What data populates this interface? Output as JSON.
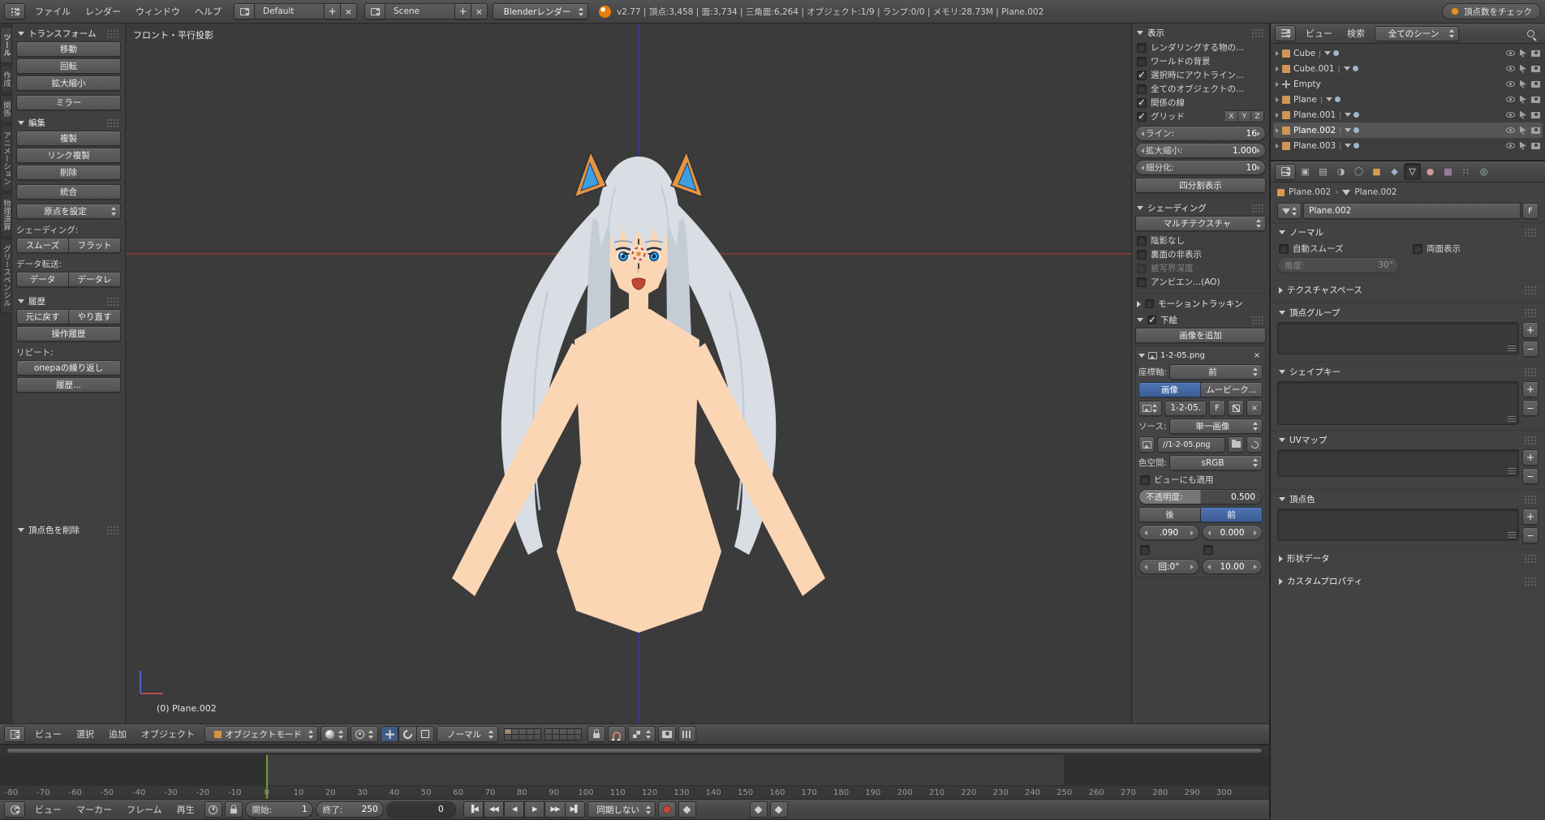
{
  "topbar": {
    "menus": [
      "ファイル",
      "レンダー",
      "ウィンドウ",
      "ヘルプ"
    ],
    "layout": {
      "value": "Default"
    },
    "scene": {
      "value": "Scene"
    },
    "engine": {
      "value": "Blenderレンダー"
    },
    "stats": "v2.77 | 頂点:3,458 | 面:3,734 | 三角面:6,264 | オブジェクト:1/9 | ランプ:0/0 | メモリ:28.73M | Plane.002",
    "job_button": "頂点数をチェック"
  },
  "toolshelf": {
    "tabs": [
      {
        "label": "ツール",
        "active": true
      },
      {
        "label": "作成"
      },
      {
        "label": "関係"
      },
      {
        "label": "アニメーション"
      },
      {
        "label": "物理演算"
      },
      {
        "label": "グリースペンシル"
      }
    ],
    "transform_title": "トランスフォーム",
    "transform_buttons": [
      "移動",
      "回転",
      "拡大縮小"
    ],
    "mirror_button": "ミラー",
    "edit_title": "編集",
    "edit_buttons": [
      "複製",
      "リンク複製",
      "削除"
    ],
    "join_button": "統合",
    "origin_button": "原点を設定",
    "shading_label": "シェーディング:",
    "smooth_button": "スムーズ",
    "flat_button": "フラット",
    "transfer_label": "データ転送:",
    "data_button": "データ",
    "data_layout_button": "データレ",
    "history_title": "履歴",
    "undo_button": "元に戻す",
    "redo_button": "やり直す",
    "history_button": "操作履歴",
    "repeat_label": "リピート:",
    "repeat_button": "операの繰り返し",
    "repeat_history_button": "履歴...",
    "vertex_color_panel": "頂点色を削除"
  },
  "viewport": {
    "view_label": "フロント・平行投影",
    "object_label": "(0) Plane.002",
    "menus": [
      "ビュー",
      "選択",
      "追加",
      "オブジェクト"
    ],
    "mode_value": "オブジェクトモード",
    "orientation_value": "ノーマル"
  },
  "npanel": {
    "display": {
      "title": "表示",
      "options": [
        {
          "label": "レンダリングする物の...",
          "checked": false
        },
        {
          "label": "ワールドの背景",
          "checked": false
        },
        {
          "label": "選択時にアウトライン...",
          "checked": true
        },
        {
          "label": "全てのオブジェクトの...",
          "checked": false
        },
        {
          "label": "関係の線",
          "checked": true
        }
      ],
      "grid_label": "グリッド",
      "grid_axes": [
        "X",
        "Y",
        "Z"
      ],
      "fields": [
        {
          "label": "ライン:",
          "value": "16"
        },
        {
          "label": "拡大縮小:",
          "value": "1.000"
        },
        {
          "label": "細分化:",
          "value": "10"
        }
      ],
      "quad_view_button": "四分割表示"
    },
    "shading": {
      "title": "シェーディング",
      "mode": "マルチテクスチャ",
      "options": [
        {
          "label": "陰影なし",
          "checked": false
        },
        {
          "label": "裏面の非表示",
          "checked": false
        },
        {
          "label": "被写界深度",
          "checked": false,
          "dimmed": true
        },
        {
          "label": "アンビエン...(AO)",
          "checked": false
        }
      ]
    },
    "motion_title": "モーショントラッキン",
    "bg": {
      "title": "下絵",
      "add_button": "画像を追加",
      "img_name": "1-2-05.png",
      "axis_label": "座標軸:",
      "axis_value": "前",
      "tab_image": "画像",
      "tab_movie": "ムービーク...",
      "datablock": "1-2-05.",
      "fake_user": "F",
      "source_label": "ソース:",
      "source_value": "単一画像",
      "filepath": "//1-2-05.png",
      "colorspace_label": "色空間:",
      "colorspace_value": "sRGB",
      "view_option": "ビューにも適用",
      "opacity_label": "不透明度:",
      "opacity_value": "0.500",
      "back_button": "後",
      "front_button": "前",
      "x_value": ".090",
      "y_value": "0.000",
      "rot_value": "回:0°",
      "size_value": "10.00"
    }
  },
  "outliner": {
    "menus": [
      "ビュー",
      "検索"
    ],
    "filter": "全てのシーン",
    "items": [
      {
        "name": "Cube",
        "type": "mesh"
      },
      {
        "name": "Cube.001",
        "type": "mesh"
      },
      {
        "name": "Empty",
        "type": "empty"
      },
      {
        "name": "Plane",
        "type": "mesh"
      },
      {
        "name": "Plane.001",
        "type": "mesh"
      },
      {
        "name": "Plane.002",
        "type": "mesh",
        "selected": true
      },
      {
        "name": "Plane.003",
        "type": "mesh"
      }
    ]
  },
  "properties": {
    "breadcrumb_object": "Plane.002",
    "breadcrumb_data": "Plane.002",
    "name_value": "Plane.002",
    "fake_user_label": "F",
    "panels": {
      "normals": "ノーマル",
      "auto_smooth": "自動スムーズ",
      "double_sided": "両面表示",
      "angle_label": "角度:",
      "angle_value": "30°",
      "texture_space": "テクスチャスペース",
      "vertex_groups": "頂点グループ",
      "shape_keys": "シェイプキー",
      "uv_maps": "UVマップ",
      "vertex_colors": "頂点色",
      "geometry_data": "形状データ",
      "custom_properties": "カスタムプロパティ"
    }
  },
  "timeline": {
    "ruler": [
      "-80",
      "-70",
      "-60",
      "-50",
      "-40",
      "-30",
      "-20",
      "-10",
      "0",
      "10",
      "20",
      "30",
      "40",
      "50",
      "60",
      "70",
      "80",
      "90",
      "100",
      "110",
      "120",
      "130",
      "140",
      "150",
      "160",
      "170",
      "180",
      "190",
      "200",
      "210",
      "220",
      "230",
      "240",
      "250",
      "260",
      "270",
      "280",
      "290",
      "300"
    ],
    "menus": [
      "ビュー",
      "マーカー",
      "フレーム",
      "再生"
    ],
    "start_label": "開始:",
    "start_value": "1",
    "end_label": "終了:",
    "end_value": "250",
    "frame_value": "0",
    "sync_value": "同期しない"
  },
  "colors": {
    "accent_blue": "#4e74b2",
    "selection_orange": "#df8c33",
    "hair_light": "#d9dee4",
    "hair_shade": "#c4ccd5",
    "skin": "#fbd6b4",
    "ear_orange": "#e6953f",
    "ear_inner_blue": "#3f9fdf",
    "eye_blue": "#2d9ce0",
    "mouth_red": "#bf4733",
    "axis_red": "#a33b3b",
    "axis_blue": "#3a3aa0",
    "frame_green": "#6f9d33"
  }
}
